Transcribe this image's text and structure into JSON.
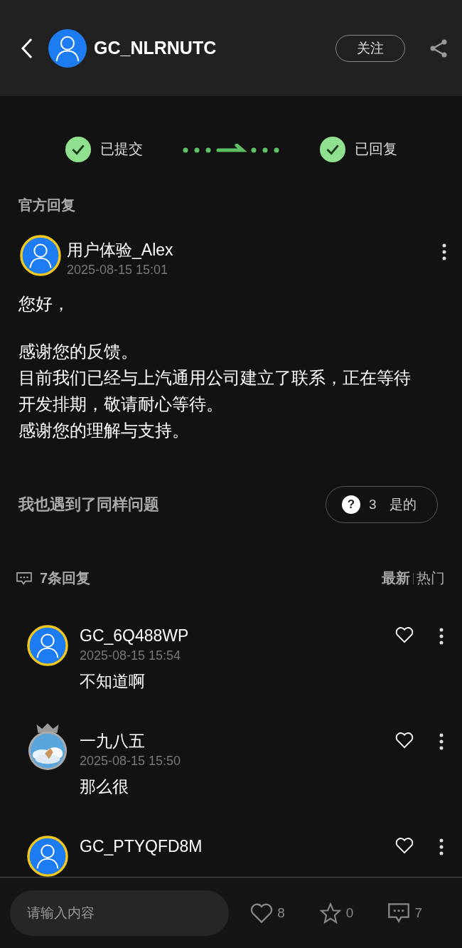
{
  "header": {
    "username": "GC_NLRNUTC",
    "follow_button": "关注"
  },
  "progress": {
    "steps": [
      {
        "label": "已提交",
        "done": true
      },
      {
        "label": "已回复",
        "done": true
      }
    ]
  },
  "official_reply": {
    "title": "官方回复",
    "author": "用户体验_Alex",
    "date": "2025-08-15 15:01",
    "paragraphs": [
      [
        "您好，"
      ],
      [
        "感谢您的反馈。",
        "目前我们已经与上汽通用公司建立了联系，正在等待开发排期，敬请耐心等待。",
        "感谢您的理解与支持。"
      ]
    ]
  },
  "same_issue": {
    "label": "我也遇到了同样问题",
    "icon": "?",
    "count": "3",
    "button": "是的"
  },
  "comments_header": {
    "count_label": "7条回复",
    "sort": [
      {
        "label": "最新",
        "selected": true
      },
      {
        "label": "热门",
        "selected": false
      }
    ]
  },
  "comments": [
    {
      "author": "GC_6Q488WP",
      "date": "2025-08-15 15:54",
      "text": "不知道啊",
      "kind": "default",
      "liked": false
    },
    {
      "author": "一九八五",
      "date": "2025-08-15 15:50",
      "text": "那么很",
      "kind": "picture",
      "liked": false
    },
    {
      "author": "GC_PTYQFD8M",
      "kind": "default",
      "liked": false
    }
  ],
  "bottom_bar": {
    "placeholder": "请输入内容",
    "likes": "8",
    "favorites": "0",
    "comments": "7"
  }
}
